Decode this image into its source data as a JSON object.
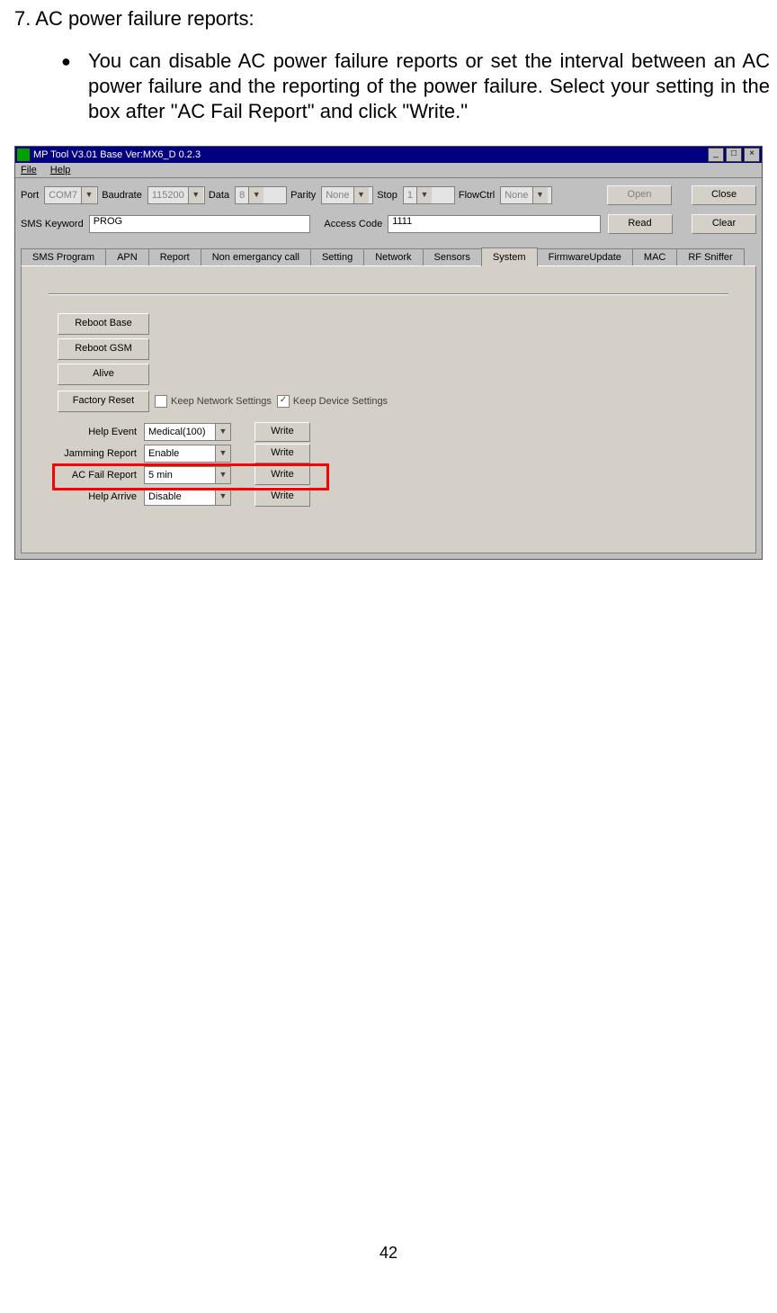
{
  "doc": {
    "section_number": "7.",
    "section_title": "AC power failure reports:",
    "bullet": "You can disable AC power failure reports or set the interval between an AC power failure and the reporting of the power failure. Select your setting in the box after \"AC Fail Report\" and click \"Write.\"",
    "page_number": "42"
  },
  "titlebar": {
    "text": "MP Tool V3.01  Base Ver:MX6_D 0.2.3",
    "min": "_",
    "max": "□",
    "close": "×"
  },
  "menubar": {
    "file": "File",
    "help": "Help"
  },
  "conn": {
    "port_label": "Port",
    "port_value": "COM7",
    "baud_label": "Baudrate",
    "baud_value": "115200",
    "data_label": "Data",
    "data_value": "8",
    "parity_label": "Parity",
    "parity_value": "None",
    "stop_label": "Stop",
    "stop_value": "1",
    "flow_label": "FlowCtrl",
    "flow_value": "None",
    "open_btn": "Open",
    "close_btn": "Close"
  },
  "sms": {
    "kw_label": "SMS Keyword",
    "kw_value": "PROG",
    "ac_label": "Access Code",
    "ac_value": "1111",
    "read_btn": "Read",
    "clear_btn": "Clear"
  },
  "tabs": {
    "t0": "SMS Program",
    "t1": "APN",
    "t2": "Report",
    "t3": "Non emergancy call",
    "t4": "Setting",
    "t5": "Network",
    "t6": "Sensors",
    "t7": "System",
    "t8": "FirmwareUpdate",
    "t9": "MAC",
    "t10": "RF Sniffer"
  },
  "system": {
    "reboot_base": "Reboot Base",
    "reboot_gsm": "Reboot GSM",
    "alive": "Alive",
    "factory_reset": "Factory Reset",
    "keep_network": "Keep Network Settings",
    "keep_device": "Keep Device Settings",
    "rows": {
      "help_event_label": "Help Event",
      "help_event_value": "Medical(100)",
      "jamming_label": "Jamming Report",
      "jamming_value": "Enable",
      "acfail_label": "AC Fail Report",
      "acfail_value": "5 min",
      "helparrive_label": "Help Arrive",
      "helparrive_value": "Disable",
      "write": "Write"
    }
  }
}
